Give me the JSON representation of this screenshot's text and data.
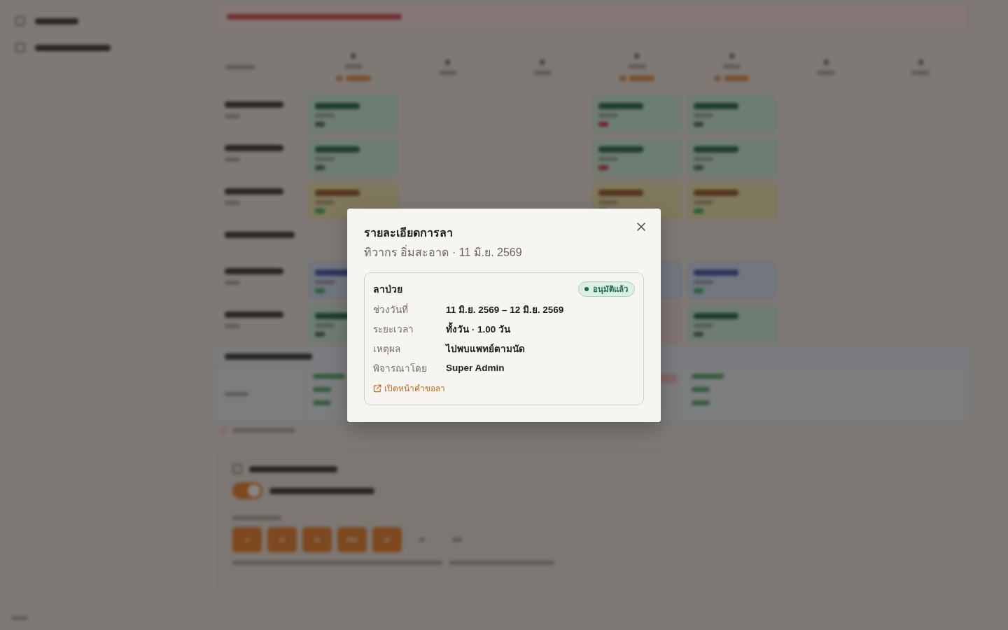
{
  "backdrop": {
    "blurred": true
  },
  "dialog": {
    "title": "รายละเอียดการลา",
    "subtitle": "ทิวากร อิ่มสะอาด · 11 มิ.ย. 2569",
    "leave": {
      "type": "ลาป่วย",
      "status": {
        "label": "อนุมัติแล้ว",
        "kind": "approved"
      },
      "details": [
        {
          "label": "ช่วงวันที่",
          "value": "11 มิ.ย. 2569 – 12 มิ.ย. 2569"
        },
        {
          "label": "ระยะเวลา",
          "value": "ทั้งวัน · 1.00 วัน"
        },
        {
          "label": "เหตุผล",
          "value": "ไปพบแพทย์ตามนัด"
        },
        {
          "label": "พิจารณาโดย",
          "value": "Super Admin"
        }
      ],
      "link": "เปิดหน้าคำขอลา"
    }
  }
}
